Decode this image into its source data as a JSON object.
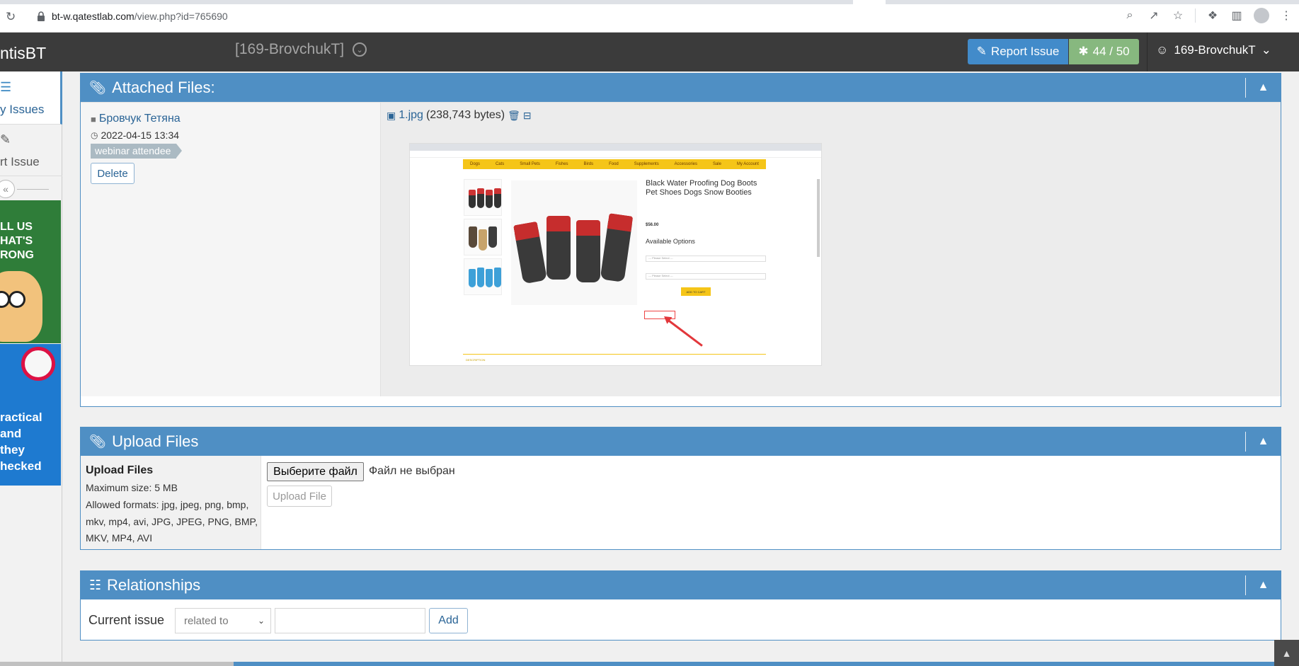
{
  "browser": {
    "url_host": "bt-w.qatestlab.com",
    "url_path": "/view.php?id=765690"
  },
  "navbar": {
    "brand": "ntisBT",
    "project": "[169-BrovchukT]",
    "report_issue": "Report Issue",
    "issue_count": "44 / 50",
    "user": "169-BrovchukT"
  },
  "sidebar": {
    "items": [
      {
        "label": "y Issues",
        "icon": "list-icon"
      },
      {
        "label": "rt Issue",
        "icon": "edit-icon"
      }
    ],
    "ad1_text": "LL US\nHAT'S\nRONG",
    "ad2_text": "ractical\nand\nthey\nhecked"
  },
  "attached": {
    "title": "Attached Files:",
    "author": "Бровчук Тетяна",
    "date": "2022-04-15 13:34",
    "badge": "webinar attendee",
    "delete_label": "Delete",
    "file_name": "1.jpg",
    "file_size": "(238,743 bytes)",
    "preview": {
      "menu": [
        "Dogs",
        "Cats",
        "Small Pets",
        "Fishes",
        "Birds",
        "Food",
        "Supplements",
        "Accessories",
        "Sale",
        "My Account"
      ],
      "product_title": "Black Water Proofing Dog Boots Pet Shoes Dogs Snow Booties",
      "price": "$56.00",
      "available_options": "Available Options",
      "select_placeholder": "--- Please Select ---",
      "add_to_cart": "ADD TO CART",
      "description": "DESCRIPTION"
    }
  },
  "upload": {
    "title": "Upload Files",
    "field_title": "Upload Files",
    "max_size": "Maximum size: 5 MB",
    "allowed": "Allowed formats: jpg, jpeg, png, bmp, mkv, mp4, avi, JPG, JPEG, PNG, BMP, MKV, MP4, AVI",
    "choose_file": "Выберите файл",
    "no_file": "Файл не выбран",
    "upload_button": "Upload File"
  },
  "relationships": {
    "title": "Relationships",
    "current_issue": "Current issue",
    "relation_selected": "related to",
    "add_label": "Add"
  },
  "colors": {
    "panel_header": "#4f8fc4",
    "navbar": "#3b3b3b",
    "report_button": "#428bca",
    "count_button": "#87b87f"
  }
}
